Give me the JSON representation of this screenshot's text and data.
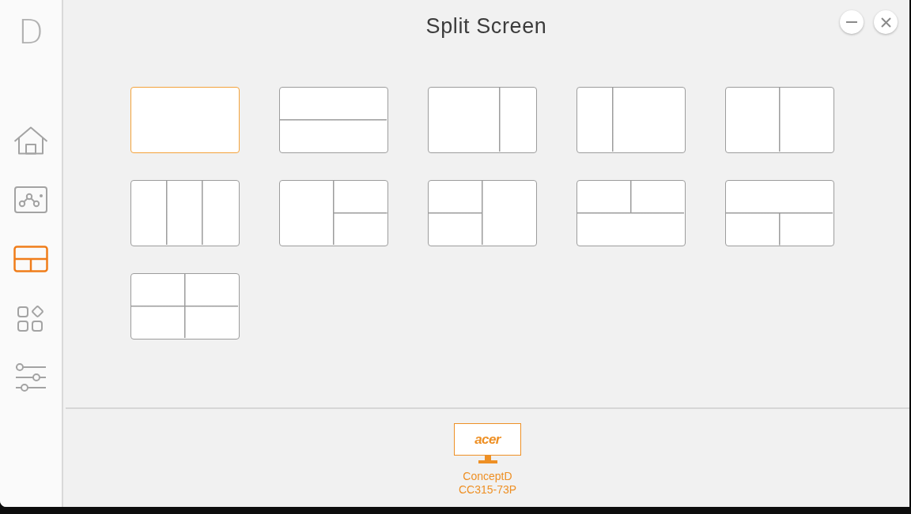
{
  "window": {
    "title": "Split Screen",
    "controls": [
      {
        "kind": "minimize"
      },
      {
        "kind": "close"
      }
    ]
  },
  "sidebar": {
    "logo": "D",
    "items": [
      {
        "kind": "home",
        "selected": false
      },
      {
        "kind": "chart",
        "selected": false
      },
      {
        "kind": "split-screen",
        "selected": true
      },
      {
        "kind": "apps",
        "selected": false
      },
      {
        "kind": "sliders",
        "selected": false
      }
    ]
  },
  "layouts": [
    {
      "kind": "full",
      "selected": true
    },
    {
      "kind": "rows-2",
      "selected": false
    },
    {
      "kind": "cols-wide-narrow",
      "selected": false
    },
    {
      "kind": "cols-narrow-wide",
      "selected": false
    },
    {
      "kind": "cols-2",
      "selected": false
    },
    {
      "kind": "cols-3",
      "selected": false
    },
    {
      "kind": "left-right-split",
      "selected": false
    },
    {
      "kind": "left-split-right",
      "selected": false
    },
    {
      "kind": "top-split-bottom",
      "selected": false
    },
    {
      "kind": "top-bottom-split",
      "selected": false
    },
    {
      "kind": "grid-4",
      "selected": false
    }
  ],
  "monitors": [
    {
      "brand": "acer",
      "name": "ConceptD",
      "model": "CC315-73P",
      "selected": true
    }
  ]
}
